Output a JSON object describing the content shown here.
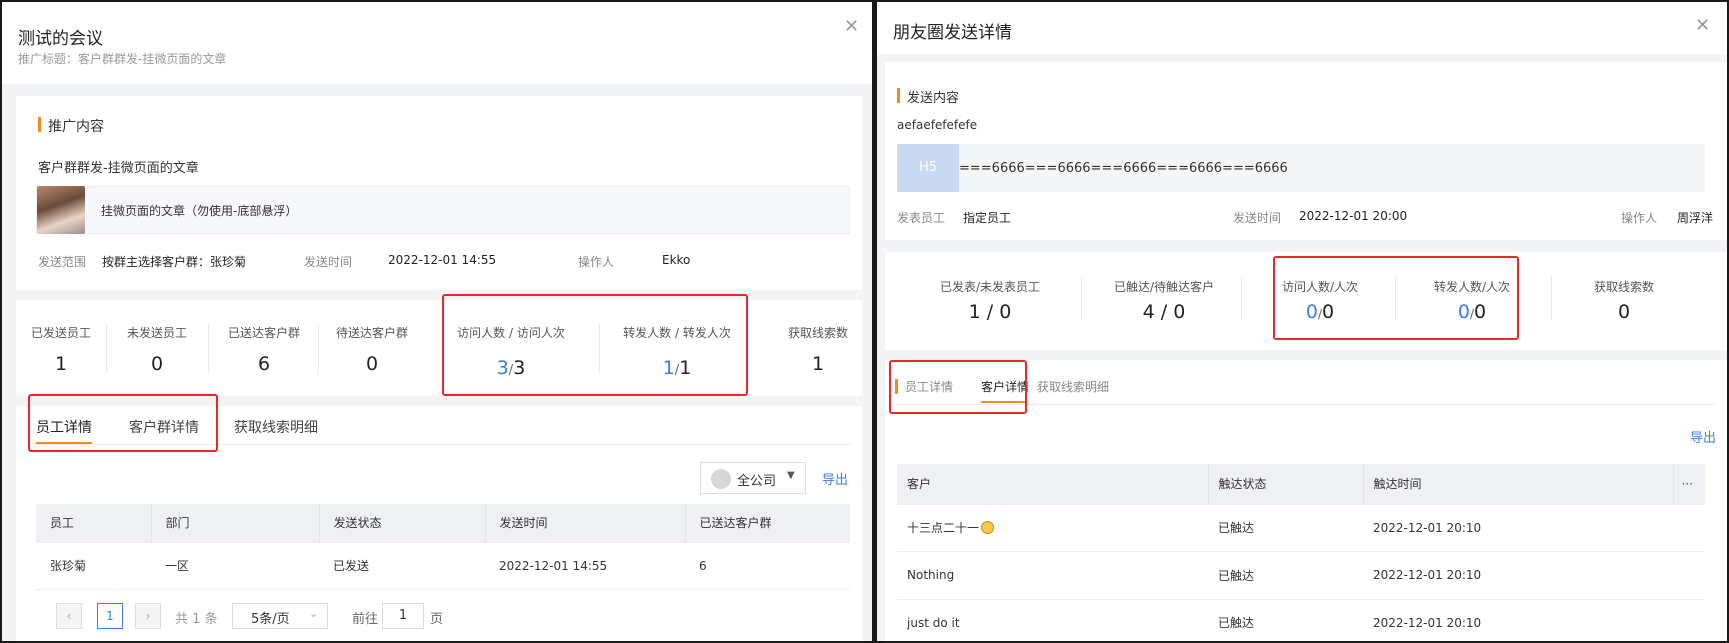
{
  "left": {
    "title": "测试的会议",
    "subtitle": "推广标题：客户群群发-挂微页面的文章",
    "promo_section": "推广内容",
    "promo_name": "客户群群发-挂微页面的文章",
    "article_title": "挂微页面的文章（勿使用-底部悬浮）",
    "meta": {
      "range_label": "发送范围",
      "range_value": "按群主选择客户群：张珍菊",
      "time_label": "发送时间",
      "time_value": "2022-12-01 14:55",
      "operator_label": "操作人",
      "operator_value": "Ekko"
    },
    "stats": [
      {
        "label": "已发送员工",
        "value": "1"
      },
      {
        "label": "未发送员工",
        "value": "0"
      },
      {
        "label": "已送达客户群",
        "value": "6"
      },
      {
        "label": "待送达客户群",
        "value": "0"
      },
      {
        "label_a": "访问人数",
        "label_b": "访问人次",
        "value_a": "3",
        "value_b": "3"
      },
      {
        "label_a": "转发人数",
        "label_b": "转发人次",
        "value_a": "1",
        "value_b": "1"
      },
      {
        "label": "获取线索数",
        "value": "1"
      }
    ],
    "tabs": [
      "员工详情",
      "客户群详情",
      "获取线索明细"
    ],
    "filter": "全公司",
    "export": "导出",
    "table": {
      "columns": [
        "员工",
        "部门",
        "发送状态",
        "发送时间",
        "已送达客户群"
      ],
      "rows": [
        [
          "张珍菊",
          "一区",
          "已发送",
          "2022-12-01 14:55",
          "6"
        ]
      ]
    },
    "pager": {
      "current": "1",
      "total": "共 1 条",
      "size": "5条/页",
      "goto": "前往",
      "page": "1",
      "page_unit": "页"
    }
  },
  "right": {
    "title": "朋友圈发送详情",
    "send_section": "发送内容",
    "send_text": "aefaefefefefe",
    "h5_label": "H5",
    "h5_text": "===6666===6666===6666===6666===6666",
    "meta": {
      "staff_label": "发表员工",
      "staff_value": "指定员工",
      "time_label": "发送时间",
      "time_value": "2022-12-01 20:00",
      "operator_label": "操作人",
      "operator_value": "周浮洋"
    },
    "stats": [
      {
        "label": "已发表/未发表员工",
        "value": "1 / 0"
      },
      {
        "label": "已触达/待触达客户",
        "value": "4 / 0"
      },
      {
        "label": "访问人数/人次",
        "value_a": "0",
        "value_b": "0"
      },
      {
        "label": "转发人数/人次",
        "value_a": "0",
        "value_b": "0"
      },
      {
        "label": "获取线索数",
        "value": "0"
      }
    ],
    "tabs": [
      "员工详情",
      "客户详情",
      "获取线索明细"
    ],
    "export": "导出",
    "table": {
      "columns": [
        "客户",
        "触达状态",
        "触达时间"
      ],
      "more": "···",
      "rows": [
        [
          "十三点二十一",
          "已触达",
          "2022-12-01 20:10"
        ],
        [
          "Nothing",
          "已触达",
          "2022-12-01 20:10"
        ],
        [
          "just do it",
          "已触达",
          "2022-12-01 20:10"
        ]
      ]
    }
  }
}
